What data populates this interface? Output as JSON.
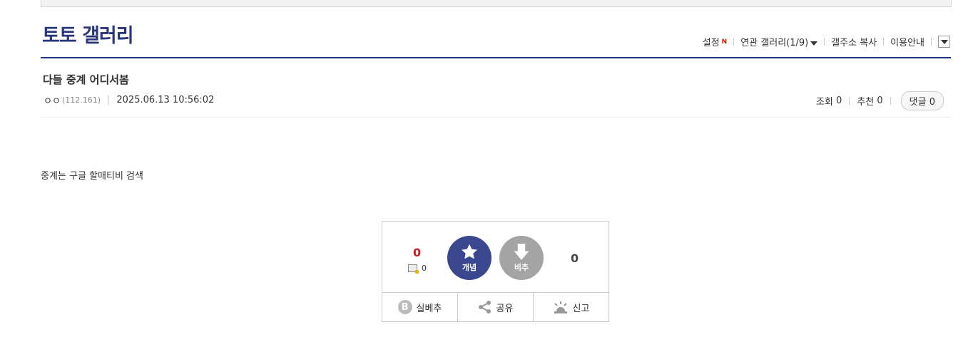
{
  "gallery": {
    "title": "토토 갤러리"
  },
  "topnav": {
    "settings": "설정",
    "new_badge": "N",
    "related": "연관 갤러리(1/9)",
    "copy_address": "갤주소 복사",
    "guide": "이용안내"
  },
  "post": {
    "title": "다들 중계 어디서봄",
    "author": "ㅇㅇ",
    "ip": "(112.161)",
    "date": "2025.06.13 10:56:02",
    "views_label": "조회",
    "views": "0",
    "recommend_label": "추천",
    "recommend": "0",
    "comments_label": "댓글",
    "comments": "0",
    "content": "중계는 구글 할매티비 검색"
  },
  "vote": {
    "up_count": "0",
    "fixed_count": "0",
    "up_label": "개념",
    "down_label": "비추",
    "down_count": "0",
    "actions": {
      "real_best": "실베추",
      "share": "공유",
      "report": "신고"
    }
  },
  "colors": {
    "brand": "#29367c",
    "up": "#3b4890",
    "down": "#a4a4a4",
    "accent_red": "#c8201e"
  }
}
